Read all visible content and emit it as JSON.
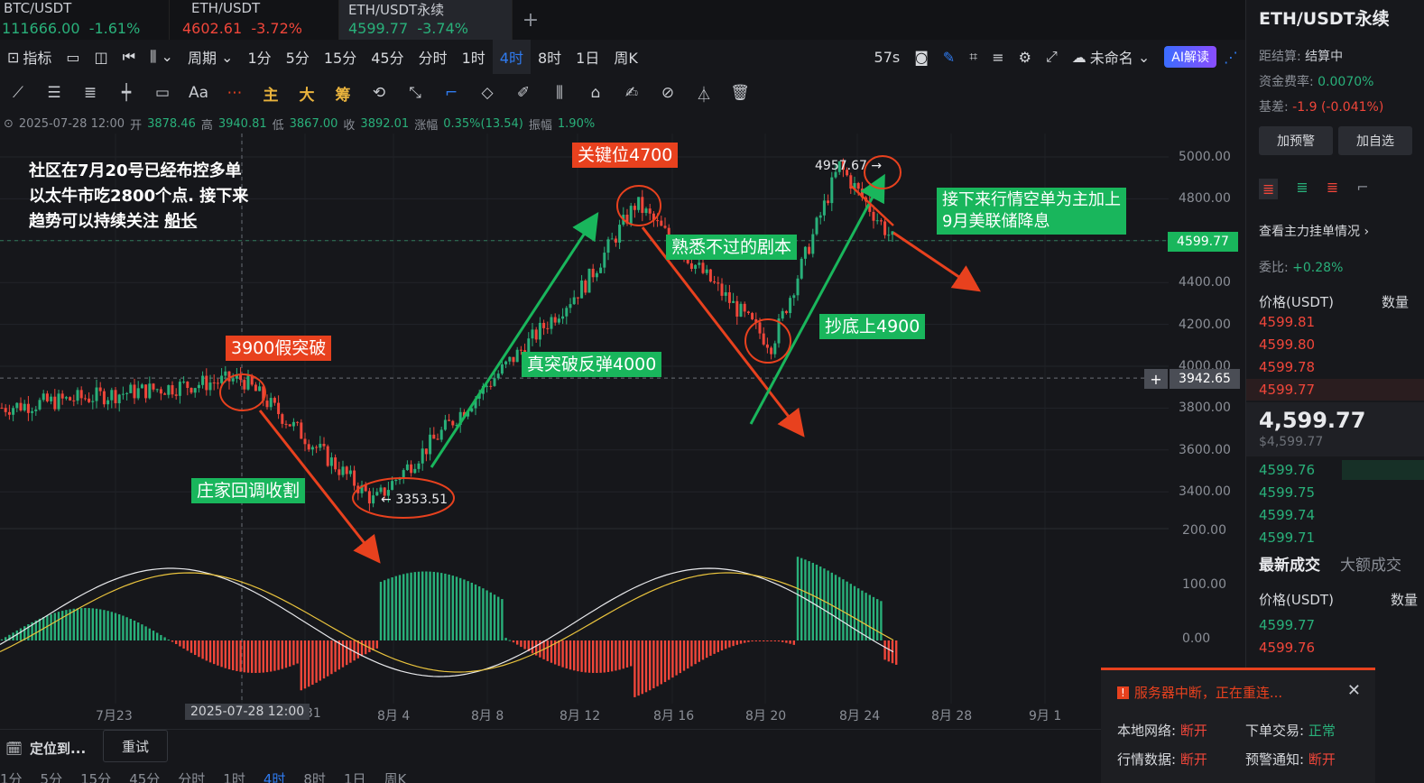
{
  "tabs": [
    {
      "symbol": "BTC/USDT",
      "price": "111666.00",
      "change": "-1.61%",
      "price_color": "#29b07a"
    },
    {
      "symbol": "ETH/USDT",
      "price": "4602.61",
      "change": "-3.72%",
      "price_color": "#f0463a"
    },
    {
      "symbol": "ETH/USDT永续",
      "price": "4599.77",
      "change": "-3.74%",
      "price_color": "#29b07a"
    }
  ],
  "toolbar": {
    "indicators": "指标",
    "period": "周期",
    "periods": [
      "1分",
      "5分",
      "15分",
      "45分",
      "分时",
      "1时",
      "4时",
      "8时",
      "1日",
      "周K"
    ],
    "selected_period": "4时",
    "timer": "57s",
    "layout_name": "未命名",
    "ai_label": "AI解读"
  },
  "drawing_tools": {
    "text_tool": "Aa",
    "main": "主",
    "big": "大",
    "chip": "筹"
  },
  "ohlc": {
    "date": "2025-07-28 12:00",
    "open_label": "开",
    "open": "3878.46",
    "high_label": "高",
    "high": "3940.81",
    "low_label": "低",
    "low": "3867.00",
    "close_label": "收",
    "close": "3892.01",
    "change_label": "涨幅",
    "change": "0.35%(13.54)",
    "amp_label": "振幅",
    "amp": "1.90%"
  },
  "annotations": {
    "left_note_1": "社区在7月20号已经布控多单",
    "left_note_2": "以太牛市吃2800个点. 接下来",
    "left_note_3": "趋势可以持续关注",
    "left_note_link": "船长",
    "fake_break": "3900假突破",
    "harvest": "庄家回调收割",
    "low_label": "3353.51",
    "true_break": "真突破反弹4000",
    "key_level": "关键位4700",
    "familiar": "熟悉不过的剧本",
    "bottom_buy": "抄底上4900",
    "high_label": "4957.67",
    "next_1": "接下来行情空单为主加上",
    "next_2": "9月美联储降息"
  },
  "price_axis": {
    "labels": [
      "5000.00",
      "4800.00",
      "4600.00",
      "4400.00",
      "4200.00",
      "4000.00",
      "3800.00",
      "3600.00",
      "3400.00"
    ],
    "current": "4599.77",
    "cursor": "3942.65",
    "macd_labels": [
      "200.00",
      "100.00",
      "0.00"
    ]
  },
  "x_axis": {
    "labels": [
      "7月23",
      "31",
      "8月 4",
      "8月 8",
      "8月 12",
      "8月 16",
      "8月 20",
      "8月 24",
      "8月 28",
      "9月 1"
    ],
    "cursor": "2025-07-28 12:00"
  },
  "chart_data": {
    "type": "candlestick",
    "interval": "4时",
    "x": [
      "7月23",
      "7月28",
      "8月 3",
      "8月 12",
      "8月 14",
      "8月 20",
      "8月 23",
      "8月 25"
    ],
    "price_path": [
      3800,
      3940,
      3353.51,
      4400,
      4780,
      4100,
      4957.67,
      4599.77
    ],
    "current_price": 4599.77,
    "marked_levels": [
      3942.65,
      4599.77
    ],
    "high": 4957.67,
    "low": 3353.51,
    "ylim": [
      3300,
      5050
    ],
    "macd_ylim": [
      -100,
      200
    ],
    "colors": {
      "up": "#29b07a",
      "down": "#f0463a",
      "dif": "#e8e9ec",
      "dea": "#e9c33d"
    }
  },
  "bottom": {
    "locate": "定位到...",
    "retry": "重试",
    "periods": [
      "1分",
      "5分",
      "15分",
      "45分",
      "分时",
      "1时",
      "4时",
      "8时",
      "1日",
      "周K"
    ]
  },
  "right_panel": {
    "title": "ETH/USDT永续",
    "settle_label": "距结算:",
    "settle_value": "结算中",
    "funding_label": "资金费率:",
    "funding_value": "0.0070%",
    "basis_label": "基差:",
    "basis_value": "-1.9 (-0.041%)",
    "alert_btn": "加预警",
    "watch_btn": "加自选",
    "orderbook_link": "查看主力挂单情况",
    "ratio_label": "委比:",
    "ratio_value": "+0.28%",
    "price_header": "价格(USDT)",
    "qty_header": "数量",
    "asks": [
      "4599.81",
      "4599.80",
      "4599.78",
      "4599.77"
    ],
    "last_price": "4,599.77",
    "last_price_usd": "$4,599.77",
    "bids": [
      "4599.76",
      "4599.75",
      "4599.74",
      "4599.71"
    ],
    "trades_tab": "最新成交",
    "big_trades_tab": "大额成交",
    "trades_price_header": "价格(USDT)",
    "trades_qty_header": "数量",
    "trades": [
      "4599.77",
      "4599.76"
    ]
  },
  "toast": {
    "title": "服务器中断，正在重连...",
    "net_label": "本地网络:",
    "net_value": "断开",
    "order_label": "下单交易:",
    "order_value": "正常",
    "market_label": "行情数据:",
    "market_value": "断开",
    "alert_label": "预警通知:",
    "alert_value": "断开"
  }
}
